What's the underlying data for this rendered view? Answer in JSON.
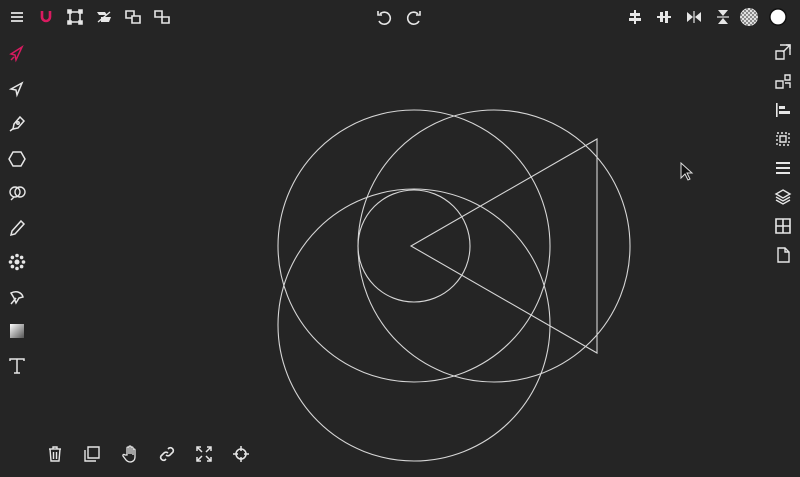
{
  "colors": {
    "background": "#252525",
    "icon": "#e6e6e6",
    "accent": "#d81b60",
    "stroke": "#d6d6d6"
  },
  "top_toolbar": {
    "left": [
      "menu-icon",
      "magnet-icon",
      "selection-icon",
      "flip-icon",
      "group-icon",
      "ungroup-icon"
    ],
    "center": [
      "undo-icon",
      "redo-icon"
    ],
    "right": [
      "align-center-horizontal-icon",
      "align-center-vertical-icon",
      "flip-horizontal-icon",
      "flip-vertical-icon",
      "pattern-fill-icon",
      "color-swatch"
    ]
  },
  "left_toolbar": {
    "tools": [
      "select-tool-icon",
      "direct-select-tool-icon",
      "pen-tool-icon",
      "polygon-tool-icon",
      "shape-builder-tool-icon",
      "pencil-tool-icon",
      "symmetry-tool-icon",
      "path-tool-icon",
      "gradient-tool-icon",
      "text-tool-icon"
    ],
    "active": "select-tool-icon"
  },
  "right_toolbar": {
    "tools": [
      "resize-icon",
      "transform-icon",
      "align-icon",
      "clip-icon",
      "layers-list-icon",
      "layers-stack-icon",
      "grid-icon",
      "document-icon"
    ]
  },
  "bottom_toolbar": {
    "tools": [
      "trash-icon",
      "duplicate-icon",
      "pan-hand-icon",
      "link-icon",
      "fit-screen-icon",
      "target-icon"
    ]
  },
  "canvas": {
    "shapes": [
      "circle",
      "circle",
      "circle",
      "circle",
      "triangle"
    ]
  }
}
